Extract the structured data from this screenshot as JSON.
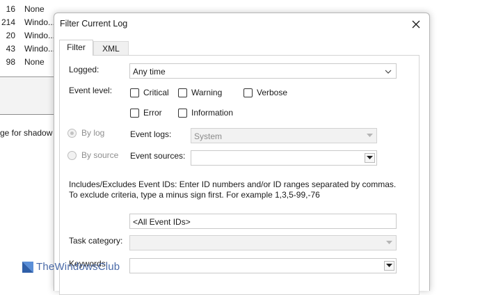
{
  "background": {
    "rows": [
      {
        "num": "16",
        "source": "None"
      },
      {
        "num": "214",
        "source": "Windo..."
      },
      {
        "num": "20",
        "source": "Windo..."
      },
      {
        "num": "43",
        "source": "Windo..."
      },
      {
        "num": "98",
        "source": "None"
      }
    ],
    "detail_text": "ge for shadow"
  },
  "dialog": {
    "title": "Filter Current Log",
    "tabs": [
      {
        "label": "Filter"
      },
      {
        "label": "XML"
      }
    ],
    "logged": {
      "label": "Logged:",
      "value": "Any time"
    },
    "event_level": {
      "label": "Event level:",
      "options": [
        "Critical",
        "Warning",
        "Verbose",
        "Error",
        "Information"
      ]
    },
    "by_log": {
      "label": "By log",
      "field_label": "Event logs:",
      "value": "System"
    },
    "by_source": {
      "label": "By source",
      "field_label": "Event sources:",
      "value": ""
    },
    "event_ids": {
      "description": "Includes/Excludes Event IDs: Enter ID numbers and/or ID ranges separated by commas. To exclude criteria, type a minus sign first. For example 1,3,5-99,-76",
      "value": "<All Event IDs>"
    },
    "task_category": {
      "label": "Task category:",
      "value": ""
    },
    "keywords": {
      "label": "Keywords:",
      "value": ""
    }
  },
  "watermark": {
    "text": "TheWindowsClub"
  },
  "colors": {
    "watermark": "#4a6aa8",
    "disabled_text": "#8f8f8f"
  }
}
